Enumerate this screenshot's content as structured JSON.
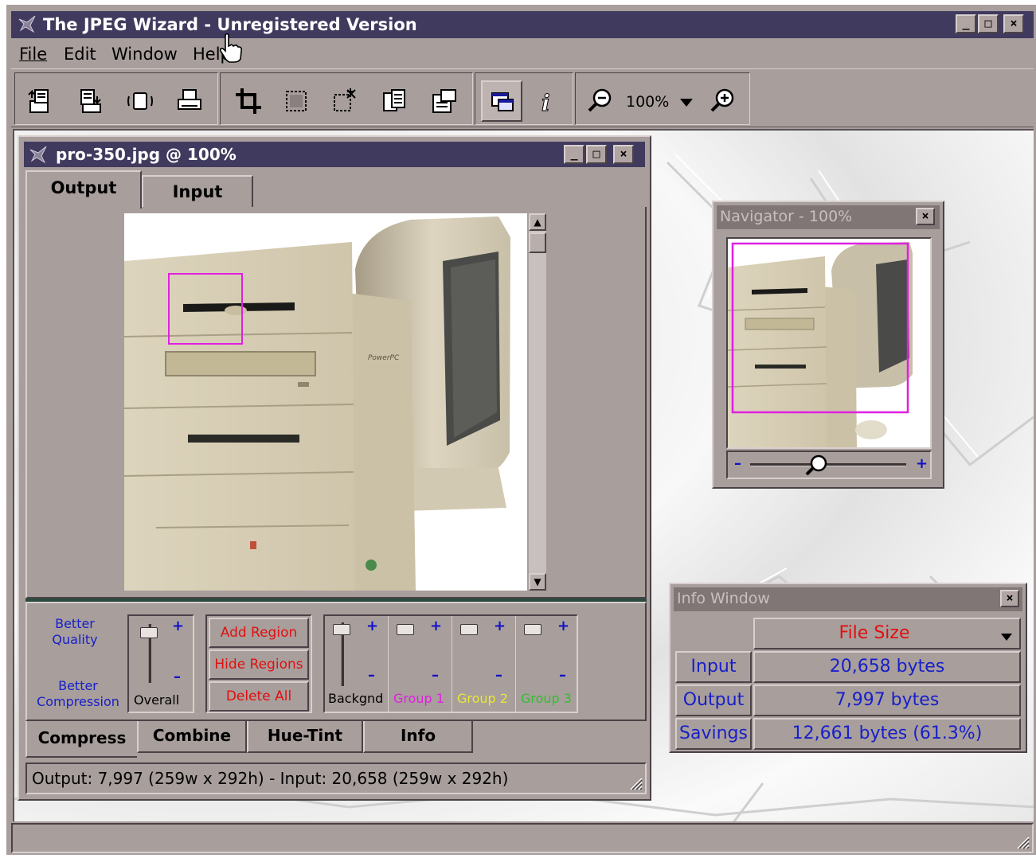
{
  "app": {
    "title": "The JPEG Wizard - Unregistered Version",
    "menu": [
      "File",
      "Edit",
      "Window",
      "Help"
    ]
  },
  "toolbar": {
    "zoom_value": "100%",
    "icons": [
      "open-icon",
      "save-icon",
      "compress-icon",
      "print-icon",
      "crop-icon",
      "select-region-icon",
      "add-region-icon",
      "copy-icon",
      "properties-icon",
      "window-toggle-icon",
      "info-icon",
      "zoom-out-icon",
      "zoom-dropdown-icon",
      "zoom-in-icon"
    ]
  },
  "document": {
    "title": "pro-350.jpg @ 100%",
    "tabs": [
      "Output",
      "Input"
    ],
    "active_tab": "Output"
  },
  "controls": {
    "better_quality": "Better Quality",
    "better_compression": "Better Compression",
    "overall_label": "Overall",
    "add_region": "Add Region",
    "hide_regions": "Hide Regions",
    "delete_all": "Delete All",
    "slider_labels": [
      "Backgnd",
      "Group 1",
      "Group 2",
      "Group 3"
    ],
    "slider_colors": [
      "#000000",
      "#e020e0",
      "#e8e830",
      "#30c030"
    ],
    "plus": "+",
    "minus": "–"
  },
  "bottom_tabs": [
    "Compress",
    "Combine",
    "Hue-Tint",
    "Info"
  ],
  "status_text": "Output: 7,997 (259w x 292h) - Input: 20,658 (259w x 292h)",
  "navigator": {
    "title": "Navigator - 100%"
  },
  "info_window": {
    "title": "Info Window",
    "metric": "File Size",
    "rows": [
      {
        "label": "Input",
        "value": "20,658 bytes"
      },
      {
        "label": "Output",
        "value": "7,997 bytes"
      },
      {
        "label": "Savings",
        "value": "12,661 bytes (61.3%)"
      }
    ]
  },
  "colors": {
    "titlebar": "#403a5e",
    "chrome": "#a89e9c",
    "region_red": "#e01010",
    "info_blue": "#1820c8"
  }
}
